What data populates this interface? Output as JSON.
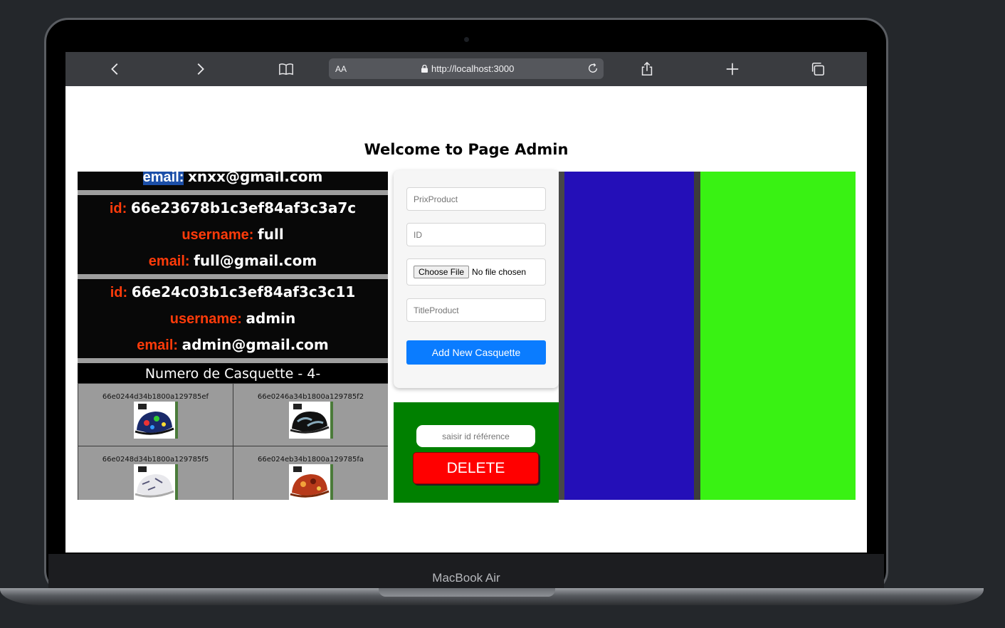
{
  "device": {
    "brand": "MacBook Air"
  },
  "browser": {
    "text_size_label": "AA",
    "url": "http://localhost:3000",
    "icons": [
      "back-icon",
      "forward-icon",
      "bookmarks-icon",
      "lock-icon",
      "reload-icon",
      "share-icon",
      "new-tab-icon",
      "tabs-icon"
    ]
  },
  "page": {
    "title": "Welcome to Page Admin",
    "users": [
      {
        "email_label": "email:",
        "email": "xnxx@gmail.com"
      },
      {
        "id_label": "id:",
        "id": "66e23678b1c3ef84af3c3a7c",
        "username_label": "username:",
        "username": "full",
        "email_label": "email:",
        "email": "full@gmail.com"
      },
      {
        "id_label": "id:",
        "id": "66e24c03b1c3ef84af3c3c11",
        "username_label": "username:",
        "username": "admin",
        "email_label": "email:",
        "email": "admin@gmail.com"
      }
    ],
    "casquettes_heading": "Numero de Casquette - 4-",
    "casquettes": [
      {
        "id": "66e0244d34b1800a129785ef"
      },
      {
        "id": "66e0246a34b1800a129785f2"
      },
      {
        "id": "66e0248d34b1800a129785f5"
      },
      {
        "id": "66e024eb34b1800a129785fa"
      }
    ],
    "form": {
      "prix_placeholder": "PrixProduct",
      "id_placeholder": "ID",
      "file_button": "Choose File",
      "file_status": "No file chosen",
      "title_placeholder": "TitleProduct",
      "submit_label": "Add New Casquette"
    },
    "delete": {
      "placeholder": "saisir id référence",
      "button_label": "DELETE"
    }
  },
  "colors": {
    "label_accent": "#ff3b0a",
    "submit_button": "#0a7cff",
    "delete_button": "#ff0000",
    "delete_panel": "#008000",
    "blue_panel": "#240fb8",
    "green_panel": "#39f213"
  }
}
